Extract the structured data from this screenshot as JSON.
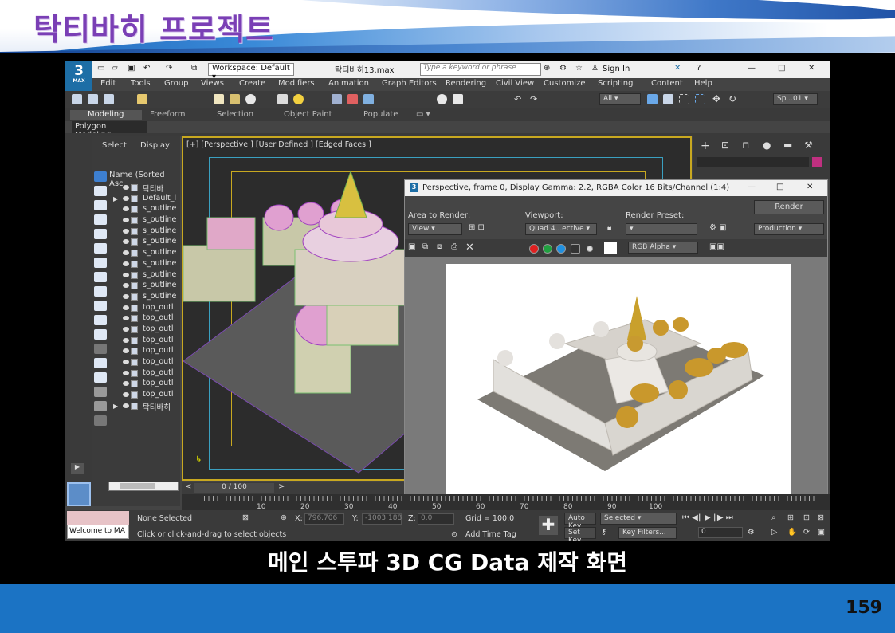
{
  "slide": {
    "title": "탁티바히 프로젝트",
    "caption": "메인 스투파 3D CG Data 제작 화면",
    "page_number": "159"
  },
  "app": {
    "logo": "3",
    "logo_sub": "MAX",
    "workspace": "Workspace: Default",
    "filename": "탁티바히13.max",
    "search_placeholder": "Type a keyword or phrase",
    "sign_in": "Sign In",
    "menu": [
      "Edit",
      "Tools",
      "Group",
      "Views",
      "Create",
      "Modifiers",
      "Animation",
      "Graph Editors",
      "Rendering",
      "Civil View",
      "Customize",
      "Scripting",
      "Content",
      "Help"
    ],
    "toolbar": {
      "filter": "All",
      "selection_set": "Sp...01"
    },
    "ribbon_tabs": [
      "Modeling",
      "Freeform",
      "Selection",
      "Object Paint",
      "Populate"
    ],
    "ribbon_sub": "Polygon Modeling"
  },
  "scene_explorer": {
    "tabs": [
      "Select",
      "Display"
    ],
    "column_header": "Name (Sorted Asc",
    "rows": [
      {
        "label": "탁티바",
        "expand": ""
      },
      {
        "label": "Default_l",
        "expand": "▶"
      },
      {
        "label": "s_outline",
        "expand": ""
      },
      {
        "label": "s_outline",
        "expand": ""
      },
      {
        "label": "s_outline",
        "expand": ""
      },
      {
        "label": "s_outline",
        "expand": ""
      },
      {
        "label": "s_outline",
        "expand": ""
      },
      {
        "label": "s_outline",
        "expand": ""
      },
      {
        "label": "s_outline",
        "expand": ""
      },
      {
        "label": "s_outline",
        "expand": ""
      },
      {
        "label": "s_outline",
        "expand": ""
      },
      {
        "label": "top_outl",
        "expand": ""
      },
      {
        "label": "top_outl",
        "expand": ""
      },
      {
        "label": "top_outl",
        "expand": ""
      },
      {
        "label": "top_outl",
        "expand": ""
      },
      {
        "label": "top_outl",
        "expand": ""
      },
      {
        "label": "top_outl",
        "expand": ""
      },
      {
        "label": "top_outl",
        "expand": ""
      },
      {
        "label": "top_outl",
        "expand": ""
      },
      {
        "label": "top_outl",
        "expand": ""
      },
      {
        "label": "탁티바히_",
        "expand": "▶"
      }
    ]
  },
  "viewport": {
    "label": "[+] [Perspective ] [User Defined ] [Edged Faces ]"
  },
  "render_frame": {
    "title": "Perspective, frame 0, Display Gamma: 2.2, RGBA Color 16 Bits/Channel (1:4)",
    "area_label": "Area to Render:",
    "area_value": "View",
    "viewport_label": "Viewport:",
    "viewport_value": "Quad 4...ective",
    "preset_label": "Render Preset:",
    "render_button": "Render",
    "production": "Production",
    "channel": "RGB Alpha"
  },
  "timeline": {
    "frame": "0 / 100",
    "ticks": [
      "10",
      "20",
      "30",
      "40",
      "50",
      "60",
      "70",
      "80",
      "90",
      "100"
    ]
  },
  "status": {
    "welcome": "Welcome to MA",
    "none_selected": "None Selected",
    "hint": "Click or click-and-drag to select objects",
    "x_label": "X:",
    "x_value": "796.706",
    "y_label": "Y:",
    "y_value": "-1003.188",
    "z_label": "Z:",
    "z_value": "0.0",
    "grid": "Grid = 100.0",
    "add_time_tag": "Add Time Tag",
    "auto_key": "Auto Key",
    "set_key": "Set Key",
    "selected": "Selected",
    "key_filters": "Key Filters...",
    "frame_field": "0"
  }
}
